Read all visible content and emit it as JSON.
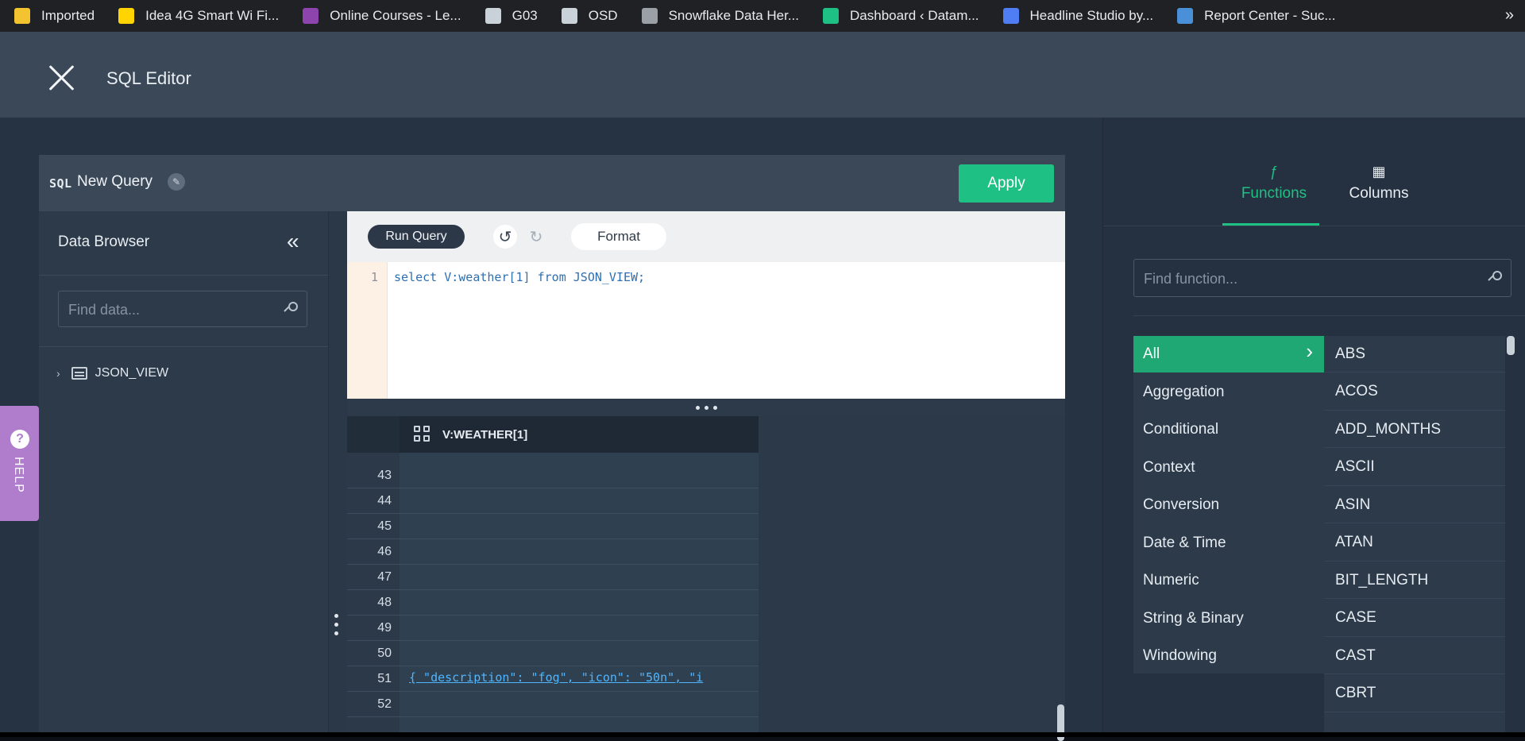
{
  "bookmarks": [
    {
      "label": "Imported",
      "color": "#f4c430"
    },
    {
      "label": "Idea 4G Smart Wi Fi...",
      "color": "#ffd400"
    },
    {
      "label": "Online Courses - Le...",
      "color": "#8e44ad"
    },
    {
      "label": "G03",
      "color": "#c9d1d9"
    },
    {
      "label": "OSD",
      "color": "#c9d1d9"
    },
    {
      "label": "Snowflake Data Her...",
      "color": "#9aa0a6"
    },
    {
      "label": "Dashboard ‹ Datam...",
      "color": "#1fc083"
    },
    {
      "label": "Headline Studio by...",
      "color": "#4f7df3"
    },
    {
      "label": "Report Center - Suc...",
      "color": "#4a90d9"
    }
  ],
  "bookmarks_more": "»",
  "header": {
    "title": "SQL Editor"
  },
  "query": {
    "badge": "SQL",
    "title": "New Query",
    "apply_label": "Apply"
  },
  "data_browser": {
    "title": "Data Browser",
    "collapse_glyph": "«",
    "search_placeholder": "Find data...",
    "tree": [
      {
        "label": "JSON_VIEW"
      }
    ]
  },
  "editor": {
    "run_label": "Run Query",
    "format_label": "Format",
    "line_number": "1",
    "code": "select V:weather[1] from JSON_VIEW;"
  },
  "results": {
    "column": "V:WEATHER[1]",
    "rows": [
      {
        "num": "43",
        "value": ""
      },
      {
        "num": "44",
        "value": ""
      },
      {
        "num": "45",
        "value": ""
      },
      {
        "num": "46",
        "value": ""
      },
      {
        "num": "47",
        "value": ""
      },
      {
        "num": "48",
        "value": ""
      },
      {
        "num": "49",
        "value": ""
      },
      {
        "num": "50",
        "value": ""
      },
      {
        "num": "51",
        "value": "{ \"description\": \"fog\", \"icon\": \"50n\", \"i"
      },
      {
        "num": "52",
        "value": ""
      }
    ]
  },
  "help": {
    "label": "HELP",
    "icon": "?"
  },
  "right_panel": {
    "tabs": [
      {
        "label": "Functions",
        "icon": "ƒ"
      },
      {
        "label": "Columns",
        "icon": "▦"
      }
    ],
    "search_placeholder": "Find function...",
    "categories": [
      "All",
      "Aggregation",
      "Conditional",
      "Context",
      "Conversion",
      "Date & Time",
      "Numeric",
      "String & Binary",
      "Windowing"
    ],
    "functions": [
      "ABS",
      "ACOS",
      "ADD_MONTHS",
      "ASCII",
      "ASIN",
      "ATAN",
      "BIT_LENGTH",
      "CASE",
      "CAST",
      "CBRT"
    ]
  },
  "colors": {
    "accent": "#1fc083",
    "header": "#3a4858",
    "panel": "#263342",
    "help": "#b07ccc"
  }
}
